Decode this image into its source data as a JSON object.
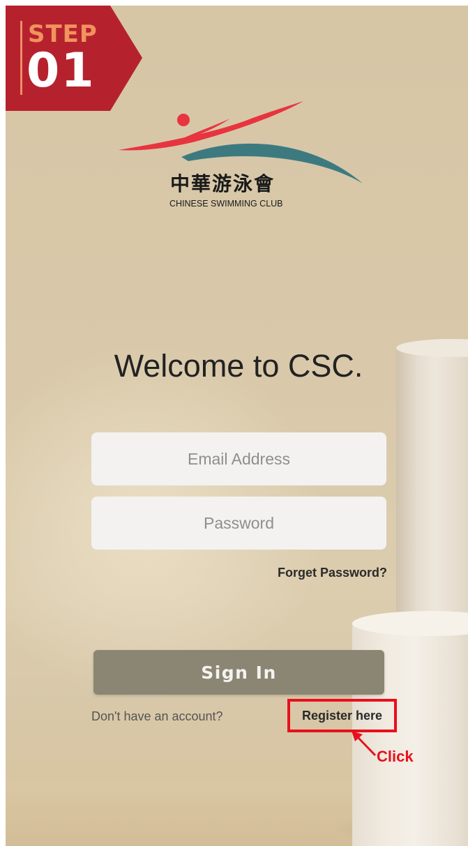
{
  "step": {
    "word": "STEP",
    "number": "01"
  },
  "brand": {
    "name_cn": "中華游泳會",
    "name_en": "CHINESE SWIMMING CLUB",
    "colors": {
      "red": "#e8343f",
      "teal": "#3d7a80"
    }
  },
  "login": {
    "title": "Welcome to CSC.",
    "email_placeholder": "Email Address",
    "password_placeholder": "Password",
    "forgot_label": "Forget Password?",
    "signin_label": "Sign In",
    "no_account_text": "Don't have an account?",
    "register_label": "Register here"
  },
  "annotation": {
    "label": "Click",
    "color": "#e8101c",
    "icon": "arrow-up-left-icon"
  },
  "colors": {
    "banner": "#b5222d",
    "signin_button": "#8a8673",
    "background": "#d8c8a8"
  }
}
